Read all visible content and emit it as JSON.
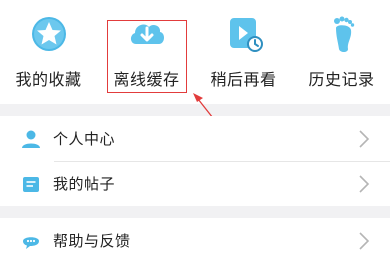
{
  "quick_actions": [
    {
      "label": "我的收藏",
      "icon": "star-icon"
    },
    {
      "label": "离线缓存",
      "icon": "cloud-download-icon"
    },
    {
      "label": "稍后再看",
      "icon": "watch-later-icon"
    },
    {
      "label": "历史记录",
      "icon": "footprint-icon"
    }
  ],
  "menu_primary": [
    {
      "label": "个人中心",
      "icon": "user-icon"
    },
    {
      "label": "我的帖子",
      "icon": "posts-icon"
    }
  ],
  "menu_secondary": [
    {
      "label": "帮助与反馈",
      "icon": "chat-bubble-icon"
    }
  ],
  "colors": {
    "accent": "#4cb8e6",
    "highlight": "#e23c3c"
  }
}
